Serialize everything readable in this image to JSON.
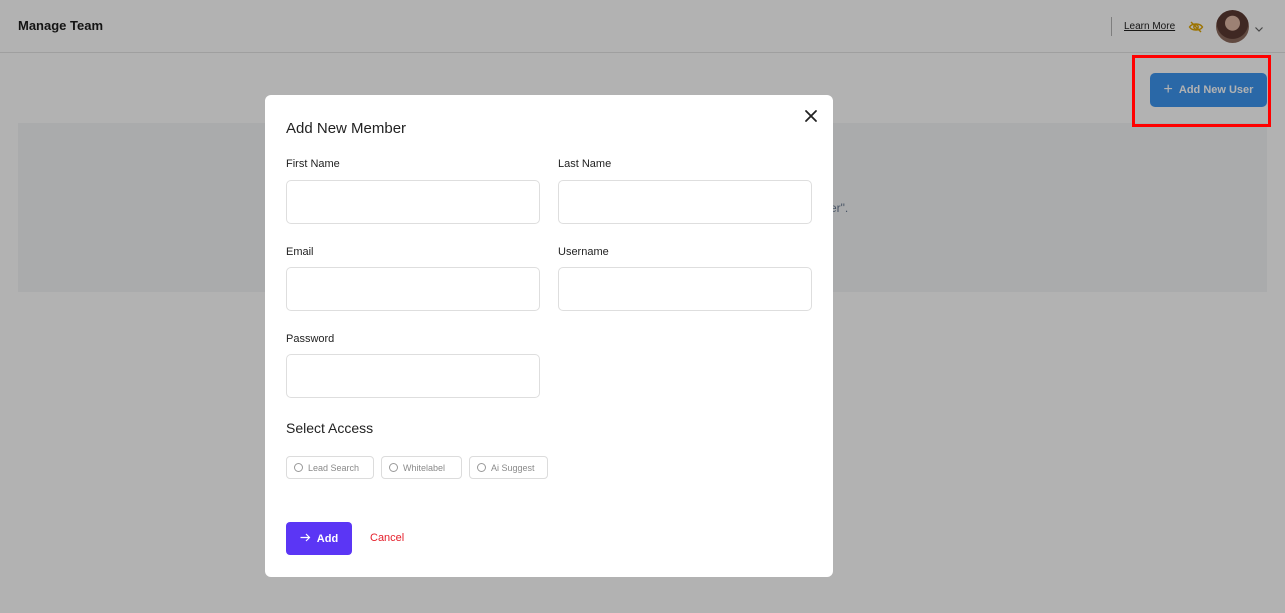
{
  "header": {
    "title": "Manage Team",
    "learn_more": "Learn More",
    "visibility_icon": "eye-off-icon",
    "avatar": "user-avatar",
    "menu_icon": "chevron-down-icon"
  },
  "toolbar": {
    "add_user_label": "Add New User",
    "add_user_icon": "plus-icon"
  },
  "background": {
    "empty_text_fragment": "er\"."
  },
  "modal": {
    "title": "Add New Member",
    "close_icon": "close-icon",
    "fields": {
      "first_name": {
        "label": "First Name",
        "value": ""
      },
      "last_name": {
        "label": "Last Name",
        "value": ""
      },
      "email": {
        "label": "Email",
        "value": ""
      },
      "username": {
        "label": "Username",
        "value": ""
      },
      "password": {
        "label": "Password",
        "value": ""
      }
    },
    "access": {
      "title": "Select Access",
      "options": [
        "Lead Search",
        "Whitelabel",
        "Ai Suggest"
      ]
    },
    "actions": {
      "add_label": "Add",
      "add_icon": "arrow-right-icon",
      "cancel_label": "Cancel"
    }
  },
  "colors": {
    "primary": "#5b36f5",
    "add_user_blue": "#3d95f0",
    "cancel_red": "#e5202c",
    "highlight": "#ff0000"
  }
}
